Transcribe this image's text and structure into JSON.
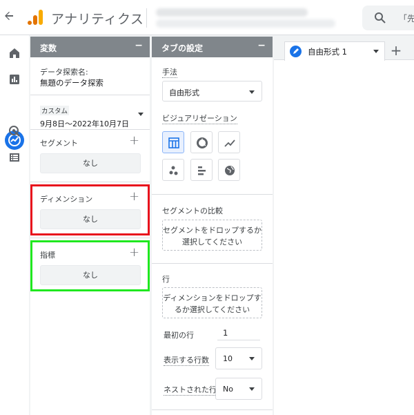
{
  "header": {
    "back_icon": "arrow-left-icon",
    "logo_icon": "analytics-logo-icon",
    "app_title": "アナリティクス",
    "search_placeholder": "「先"
  },
  "left_nav": {
    "items": [
      {
        "icon": "home-icon"
      },
      {
        "icon": "reports-icon"
      },
      {
        "icon": "explore-icon",
        "active": true
      },
      {
        "icon": "advertising-icon"
      },
      {
        "icon": "configure-icon"
      }
    ],
    "active_color": "#1a73e8"
  },
  "variables_panel": {
    "title": "変数",
    "collapse": "−",
    "exploration_name_label": "データ探索名:",
    "exploration_name_value": "無題のデータ探索",
    "date_range_label": "カスタム",
    "date_range_value": "9月8日～2022年10月7日",
    "segments": {
      "label": "セグメント",
      "empty": "なし"
    },
    "dimensions": {
      "label": "ディメンション",
      "empty": "なし"
    },
    "metrics": {
      "label": "指標",
      "empty": "なし"
    }
  },
  "tab_settings_panel": {
    "title": "タブの設定",
    "collapse": "−",
    "technique_label": "手法",
    "technique_value": "自由形式",
    "visualization_label": "ビジュアリゼーション",
    "visualizations": [
      "table-icon",
      "donut-chart-icon",
      "line-chart-icon",
      "scatter-plot-icon",
      "bar-chart-icon",
      "geo-map-icon"
    ],
    "segment_compare_label": "セグメントの比較",
    "segment_drop_text": "セグメントをドロップするか選択してください",
    "rows_label": "行",
    "dimension_drop_text": "ディメンションをドロップするか選択してください",
    "first_row_label": "最初の行",
    "first_row_value": "1",
    "rows_shown_label": "表示する行数",
    "rows_shown_value": "10",
    "nested_rows_label": "ネストされた行",
    "nested_rows_value": "No"
  },
  "canvas": {
    "tab_label": "自由形式 1",
    "add_tab": "+"
  },
  "highlights": {
    "dimension_color": "#e8101c",
    "metric_color": "#1fe81f"
  }
}
